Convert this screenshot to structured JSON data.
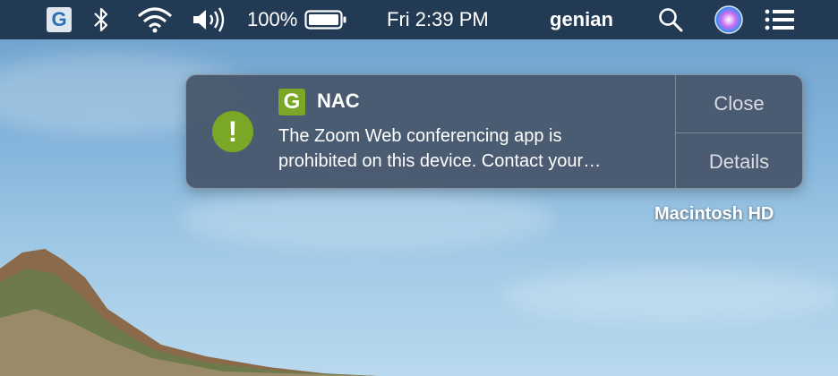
{
  "menubar": {
    "app_icon": "genian-g-icon",
    "app_icon_letter": "G",
    "bluetooth_icon": "bluetooth-icon",
    "wifi_icon": "wifi-icon",
    "volume_icon": "volume-icon",
    "battery_percent": "100%",
    "battery_icon": "battery-icon",
    "clock": "Fri 2:39 PM",
    "user": "genian",
    "spotlight_icon": "search-icon",
    "siri_icon": "siri-icon",
    "notification_center_icon": "list-icon"
  },
  "notification": {
    "alert_icon": "exclamation-icon",
    "alert_glyph": "!",
    "app_logo_letter": "G",
    "app_name": "NAC",
    "body_line1": "The Zoom Web conferencing app is",
    "body_line2": "prohibited on this device. Contact your…",
    "close_label": "Close",
    "details_label": "Details"
  },
  "desktop": {
    "disk_label": "Macintosh HD"
  },
  "colors": {
    "menubar_bg": "#233a55",
    "alert_green": "#7aa726",
    "notification_bg": "#465569"
  }
}
